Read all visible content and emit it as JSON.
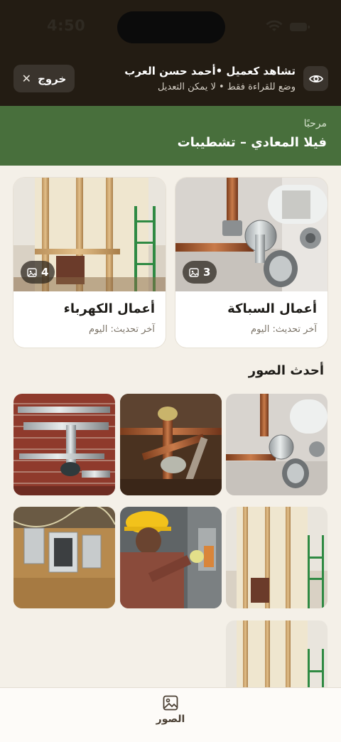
{
  "status_bar": {
    "time": "4:50"
  },
  "viewer_banner": {
    "exit_label": "خروج",
    "title": "تشاهد كعميل •أحمد حسن العرب",
    "subtitle": "وضع للقراءة فقط • لا يمكن التعديل"
  },
  "project": {
    "greeting": "مرحبًا",
    "name": "فيلا المعادي – تشطيبات"
  },
  "categories": [
    {
      "title": "أعمال السباكة",
      "updated": "آخر تحديث: اليوم",
      "count": "3",
      "photo": "plumbing-valve"
    },
    {
      "title": "أعمال الكهرباء",
      "updated": "آخر تحديث: اليوم",
      "count": "4",
      "photo": "wall-studs"
    }
  ],
  "recent": {
    "title": "أحدث الصور",
    "photos": [
      "plumbing-valve",
      "copper-pipes",
      "brick-wall-pipes",
      "wall-studs",
      "electrician-worker",
      "electrical-panels",
      "wall-studs"
    ]
  },
  "bottom_nav": {
    "photos_label": "الصور",
    "icon": "image-icon"
  },
  "colors": {
    "banner_bg": "#231c13",
    "header_green": "#486f3c",
    "page_bg": "#f4f0e8"
  }
}
